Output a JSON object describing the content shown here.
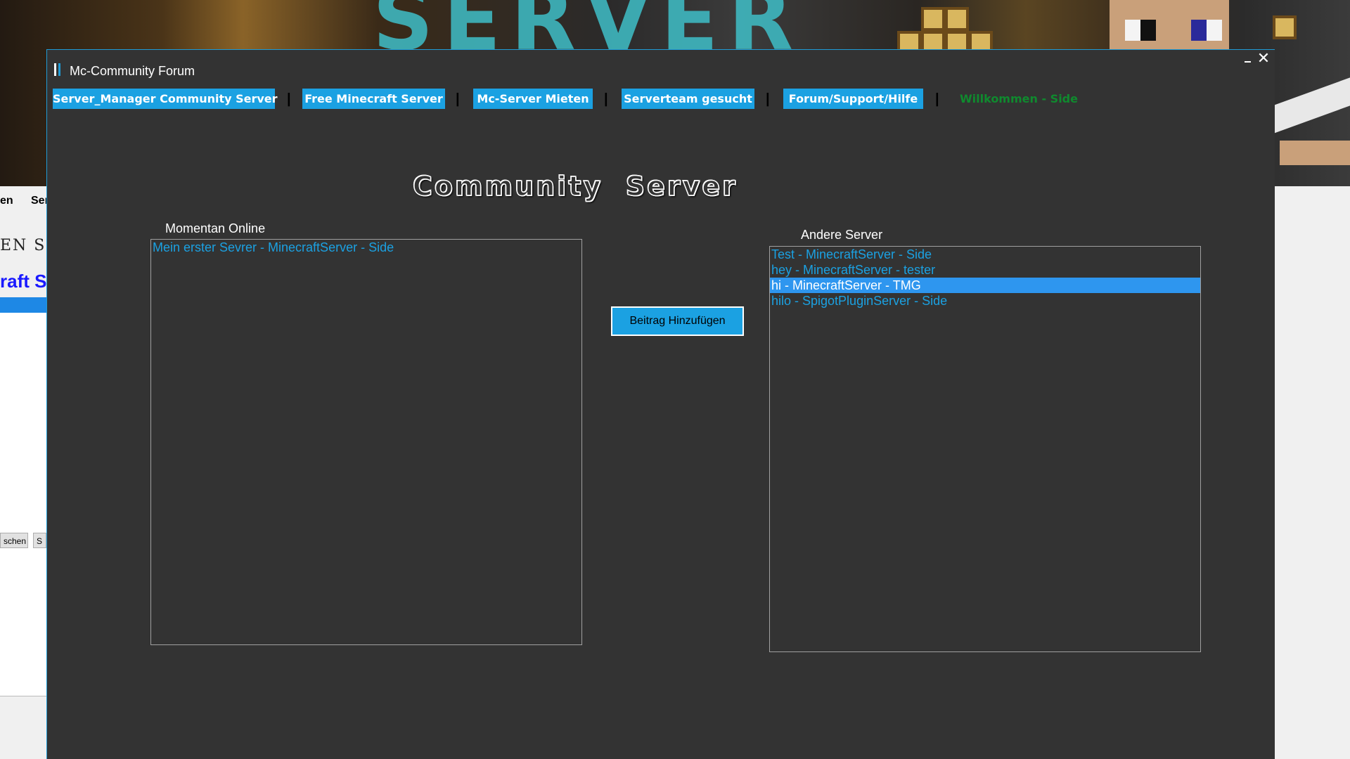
{
  "background": {
    "banner_text": "SERVER",
    "left_fragments": [
      "en",
      "Ser",
      "EN SER",
      "raft S"
    ],
    "left_buttons": [
      "schen",
      "S"
    ]
  },
  "window": {
    "title": "Mc-Community Forum",
    "minimize_icon": "minimize-icon",
    "close_icon": "✕"
  },
  "nav": {
    "items": [
      {
        "label": "Server_Manager Community Server"
      },
      {
        "label": "Free Minecraft Server"
      },
      {
        "label": "Mc-Server Mieten"
      },
      {
        "label": "Serverteam gesucht"
      },
      {
        "label": "Forum/Support/Hilfe"
      }
    ],
    "separator": "|",
    "welcome": "Willkommen - Side"
  },
  "heading": "Community  Server",
  "online": {
    "label": "Momentan Online",
    "items": [
      "Mein erster Sevrer - MinecraftServer - Side"
    ]
  },
  "others": {
    "label": "Andere Server",
    "items": [
      "Test - MinecraftServer - Side",
      "hey - MinecraftServer - tester",
      "hi - MinecraftServer - TMG",
      "hilo - SpigotPluginServer - Side"
    ],
    "selected_index": 2
  },
  "actions": {
    "add_post": "Beitrag Hinzufügen"
  },
  "colors": {
    "window_bg": "#333333",
    "accent": "#1ba1e2",
    "selection": "#2e96ef",
    "welcome_text": "#0f8a2e"
  }
}
